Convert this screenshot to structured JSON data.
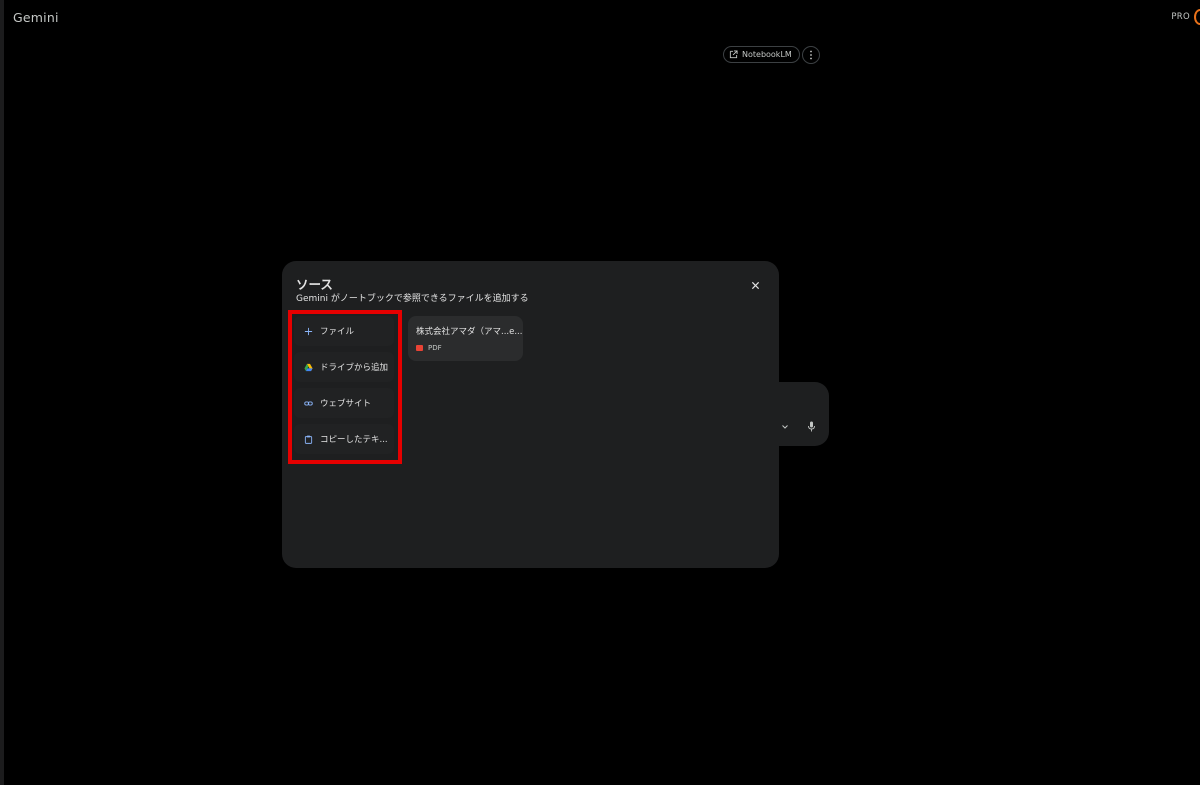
{
  "app": {
    "title": "Gemini",
    "badge": "PRO"
  },
  "header": {
    "notebooklm_label": "NotebookLM"
  },
  "modal": {
    "title": "ソース",
    "subtitle": "Gemini がノートブックで参照できるファイルを追加する",
    "options": [
      {
        "icon": "plus-icon",
        "label": "ファイル"
      },
      {
        "icon": "google-drive-icon",
        "label": "ドライブから追加"
      },
      {
        "icon": "link-icon",
        "label": "ウェブサイト"
      },
      {
        "icon": "clipboard-icon",
        "label": "コピーしたテキ..."
      }
    ],
    "sources": [
      {
        "name": "株式会社アマダ（アマ...e...",
        "type": "PDF",
        "type_icon": "pdf-icon"
      }
    ]
  },
  "colors": {
    "background": "#000000",
    "modal_bg": "#1e1f20",
    "accent_blue": "#8ab4f8",
    "highlight": "#e60000",
    "pdf": "#e94335"
  }
}
